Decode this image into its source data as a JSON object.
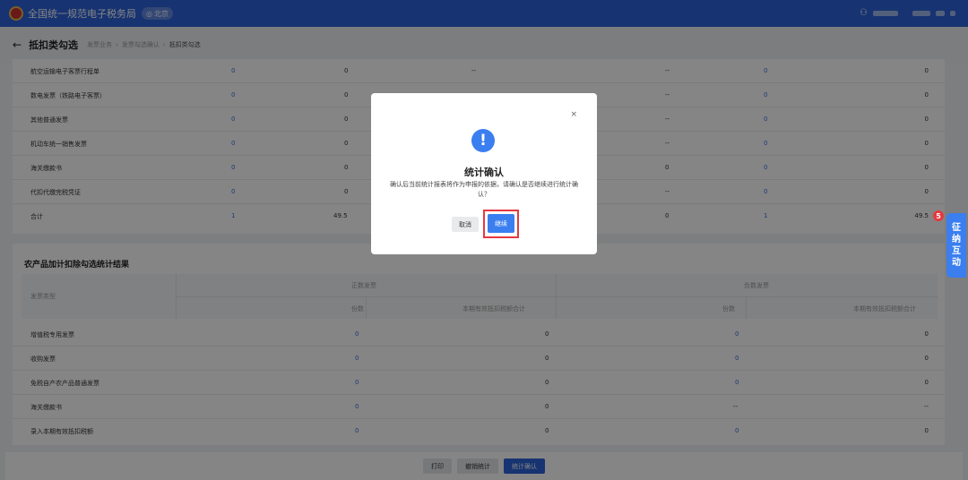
{
  "header": {
    "site_title": "全国统一规范电子税务局",
    "region": "北京",
    "user_icon": "user-icon",
    "colors": {
      "brand": "#2d62d9",
      "accent": "#3a7ef0",
      "badge": "#e6393f"
    }
  },
  "breadcrumb": {
    "page_title": "抵扣类勾选",
    "items": [
      "发票业务",
      "发票勾选确认",
      "抵扣类勾选"
    ]
  },
  "table1": {
    "rows": [
      {
        "label": "航空运输电子客票行程单",
        "c1": "0",
        "c2": "0",
        "c3": "--",
        "c4": "--",
        "c5": "0",
        "c6": "0"
      },
      {
        "label": "数电发票（铁路电子客票）",
        "c1": "0",
        "c2": "0",
        "c3": "",
        "c4": "--",
        "c5": "0",
        "c6": "0"
      },
      {
        "label": "其他普通发票",
        "c1": "0",
        "c2": "0",
        "c3": "",
        "c4": "--",
        "c5": "0",
        "c6": "0"
      },
      {
        "label": "机动车统一销售发票",
        "c1": "0",
        "c2": "0",
        "c3": "",
        "c4": "--",
        "c5": "0",
        "c6": "0"
      },
      {
        "label": "海关缴款书",
        "c1": "0",
        "c2": "0",
        "c3": "",
        "c4": "0",
        "c5": "0",
        "c6": "0"
      },
      {
        "label": "代扣代缴完税凭证",
        "c1": "0",
        "c2": "0",
        "c3": "",
        "c4": "--",
        "c5": "0",
        "c6": "0"
      },
      {
        "label": "合计",
        "c1": "1",
        "c2": "49.5",
        "c3": "",
        "c4": "0",
        "c5": "1",
        "c6": "49.5"
      }
    ]
  },
  "table2": {
    "title": "农产品加计扣除勾选统计结果",
    "headers": {
      "type": "发票类型",
      "positive": "正数发票",
      "negative": "负数发票",
      "count": "份数",
      "amount": "本期有效抵扣税额合计"
    },
    "rows": [
      {
        "label": "增值税专用发票",
        "p_count": "0",
        "p_amount": "0",
        "n_count": "0",
        "n_amount": "0"
      },
      {
        "label": "收购发票",
        "p_count": "0",
        "p_amount": "0",
        "n_count": "0",
        "n_amount": "0"
      },
      {
        "label": "免税自产农产品普通发票",
        "p_count": "0",
        "p_amount": "0",
        "n_count": "0",
        "n_amount": "0"
      },
      {
        "label": "海关缴款书",
        "p_count": "0",
        "p_amount": "0",
        "n_count": "--",
        "n_amount": "--"
      },
      {
        "label": "录入本期有效抵扣税额",
        "p_count": "0",
        "p_amount": "0",
        "n_count": "0",
        "n_amount": "0"
      }
    ]
  },
  "bottom_buttons": {
    "print": "打印",
    "cancel_stat": "撤销统计",
    "confirm_stat": "统计确认"
  },
  "modal": {
    "title": "统计确认",
    "message": "确认后当前统计报表将作为申报的依据，请确认是否继续进行统计确认？",
    "cancel": "取消",
    "continue": "继续",
    "close_icon": "close-icon",
    "warn_icon": "exclamation-icon"
  },
  "side_widget": {
    "chars": [
      "征",
      "纳",
      "互",
      "动"
    ],
    "badge_count": "5"
  }
}
